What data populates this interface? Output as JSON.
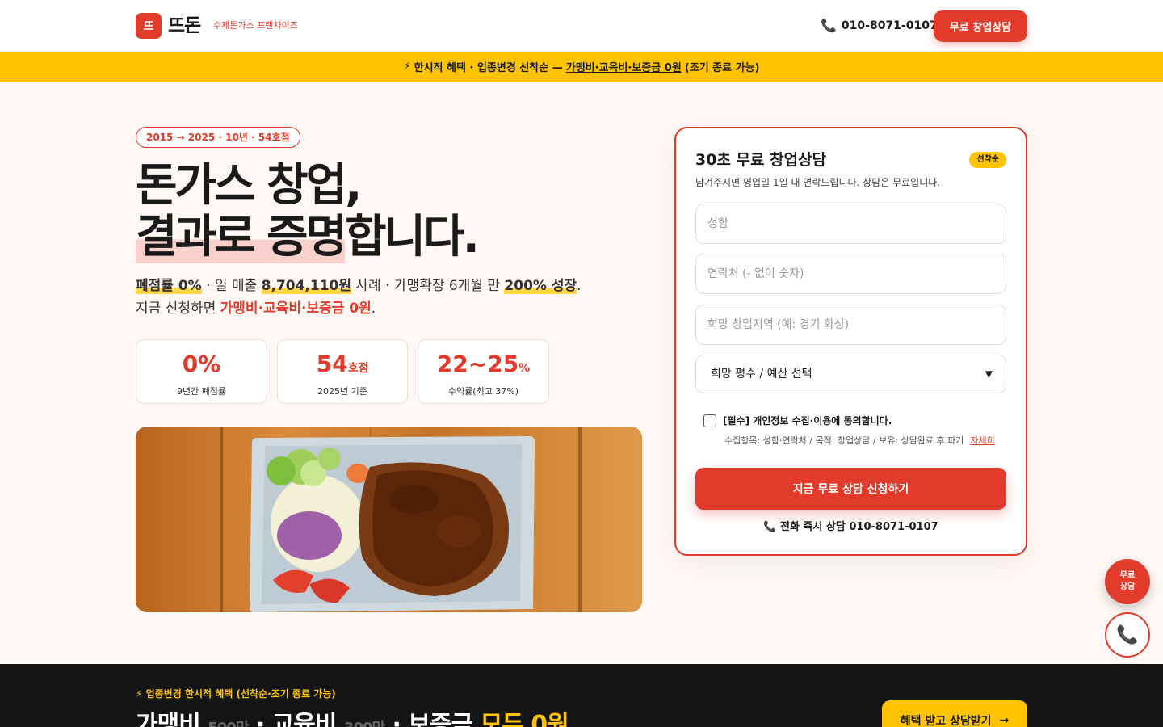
{
  "header": {
    "logo_badge": "뜨",
    "logo_text": "뜨돈",
    "logo_sub": "수제돈가스 프랜차이즈",
    "phone_icon": "phone-icon",
    "phone": "010-8071-0107",
    "cta": "무료 창업상담"
  },
  "promo": {
    "icon": "⚡",
    "text_lead": "한시적 혜택 · 업종변경 선착순 —",
    "text_highlight": "가맹비·교육비·보증금 0원",
    "text_tail": "(조기 종료 가능)"
  },
  "hero": {
    "pill": "2015 → 2025 · 10년 · 54호점",
    "title_line1": "돈가스 창업,",
    "title_line2_hl": "결과로 증명",
    "title_line2_rest": "합니다.",
    "lead": {
      "a": "폐점률 0%",
      "b": " · 일 매출 ",
      "c": "8,704,110원",
      "d": " 사례 · 가맹확장 6개월 만 ",
      "e": "200% 성장",
      "f": ".",
      "g": "지금 신청하면 ",
      "h": "가맹비·교육비·보증금 0원",
      "i": "."
    },
    "stats": [
      {
        "value": "0%",
        "unit": "",
        "label": "9년간 폐점률"
      },
      {
        "value": "54",
        "unit": "호점",
        "label": "2025년 기준"
      },
      {
        "value": "22~25",
        "unit": "%",
        "label": "수익률(최고 37%)"
      }
    ]
  },
  "form": {
    "title": "30초 무료 창업상담",
    "badge": "선착순",
    "desc": "남겨주시면 영업일 1일 내 연락드립니다. 상담은 무료입니다.",
    "name_placeholder": "성함",
    "phone_placeholder": "연락처 (- 없이 숫자)",
    "region_placeholder": "희망 창업지역 (예: 경기 화성)",
    "select_value": "희망 평수 / 예산 선택",
    "consent_label": "[필수] 개인정보 수집·이용에 동의합니다.",
    "consent_note": "수집항목: 성함·연락처 / 목적: 창업상담 / 보유: 상담완료 후 파기",
    "consent_more": "자세히",
    "submit": "지금 무료 상담 신청하기",
    "call_text": "전화 즉시 상담 010-8071-0107"
  },
  "floating": {
    "consult_line1": "무료",
    "consult_line2": "상담"
  },
  "band": {
    "tag": "⚡ 업종변경 한시적 혜택 (선착순·조기 종료 가능)",
    "h_a": "가맹비 ",
    "h_a_old": "500만",
    "h_b": " · 교육비 ",
    "h_b_old": "300만",
    "h_c": " · 보증금 ",
    "h_d": "모두 0원",
    "cta": "혜택 받고 상담받기",
    "cta_icon": "→"
  },
  "colors": {
    "brand": "#e33b2b",
    "accent": "#ffc300",
    "dark": "#141414"
  }
}
